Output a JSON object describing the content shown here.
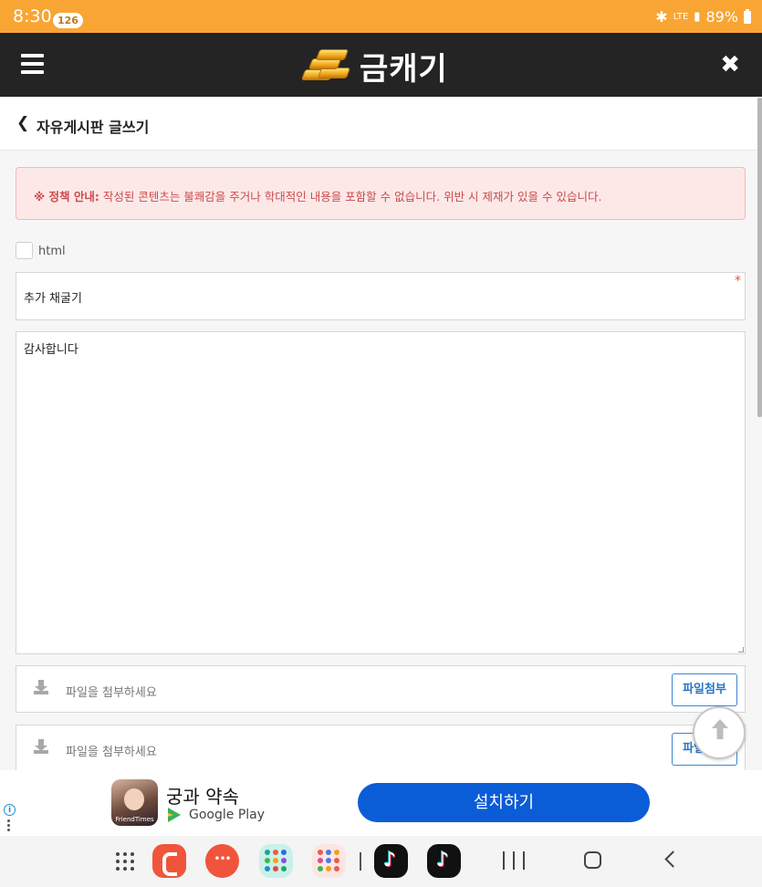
{
  "status_bar": {
    "time": "8:30",
    "notification_count": "126",
    "network": "LTE",
    "battery": "89%"
  },
  "app_header": {
    "brand_name": "금캐기",
    "icons": {
      "menu": "hamburger-menu-icon",
      "logo": "gold-bars-icon",
      "close": "close-icon"
    }
  },
  "page": {
    "title": "자유게시판 글쓰기",
    "back_icon": "chevron-left-icon"
  },
  "notice": {
    "label": "※ 정책 안내:",
    "text": "작성된 콘텐츠는 불쾌감을 주거나 학대적인 내용을 포함할 수 없습니다. 위반 시 제재가 있을 수 있습니다."
  },
  "form": {
    "html_option_label": "html",
    "html_checked": false,
    "subject_value": "추가 채굴기",
    "required_mark": "*",
    "content_value": "감사합니다",
    "file_rows": [
      {
        "placeholder": "파일을 첨부하세요",
        "button_label": "파일첨부"
      },
      {
        "placeholder": "파일을 첨부하세요",
        "button_label": "파일첨부"
      }
    ]
  },
  "ad": {
    "app_name": "궁과 약속",
    "icon_caption": "FriendTimes",
    "store": "Google Play",
    "install_label": "설치하기",
    "colors": {
      "install_button": "#0b5cd7"
    }
  },
  "colors": {
    "status_bar": "#f8a534",
    "header": "#242424",
    "notice_bg": "#fde8e8",
    "notice_text": "#c94b4b",
    "attach_button": "#2c76c2"
  }
}
